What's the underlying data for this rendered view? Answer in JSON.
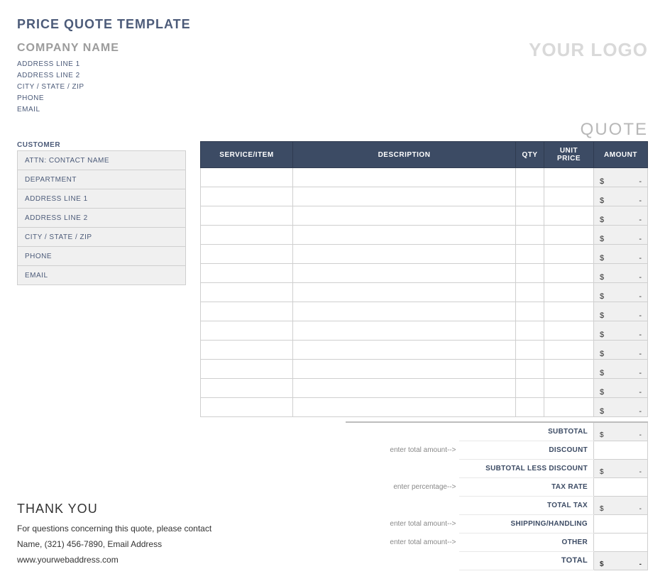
{
  "title": "PRICE QUOTE TEMPLATE",
  "company": {
    "name": "COMPANY NAME",
    "addr1": "ADDRESS LINE 1",
    "addr2": "ADDRESS LINE 2",
    "csz": "CITY / STATE / ZIP",
    "phone": "PHONE",
    "email": "EMAIL"
  },
  "logo": "YOUR LOGO",
  "quote_word": "QUOTE",
  "customer": {
    "label": "CUSTOMER",
    "rows": [
      "ATTN: CONTACT NAME",
      "DEPARTMENT",
      "ADDRESS LINE 1",
      "ADDRESS LINE 2",
      "CITY / STATE / ZIP",
      "PHONE",
      "EMAIL"
    ]
  },
  "items": {
    "headers": {
      "service": "SERVICE/ITEM",
      "desc": "DESCRIPTION",
      "qty": "QTY",
      "unit": "UNIT PRICE",
      "amount": "AMOUNT"
    },
    "currency": "$",
    "empty": "-",
    "row_count": 13
  },
  "totals": {
    "subtotal": "SUBTOTAL",
    "discount": "DISCOUNT",
    "subtotal_less": "SUBTOTAL LESS DISCOUNT",
    "tax_rate": "TAX RATE",
    "total_tax": "TOTAL TAX",
    "shipping": "SHIPPING/HANDLING",
    "other": "OTHER",
    "total": "TOTAL",
    "hint_amount": "enter total amount-->",
    "hint_pct": "enter percentage-->"
  },
  "thanks": {
    "title": "THANK YOU",
    "line1": "For questions concerning this quote, please contact",
    "line2": "Name, (321) 456-7890, Email Address",
    "line3": "www.yourwebaddress.com"
  }
}
